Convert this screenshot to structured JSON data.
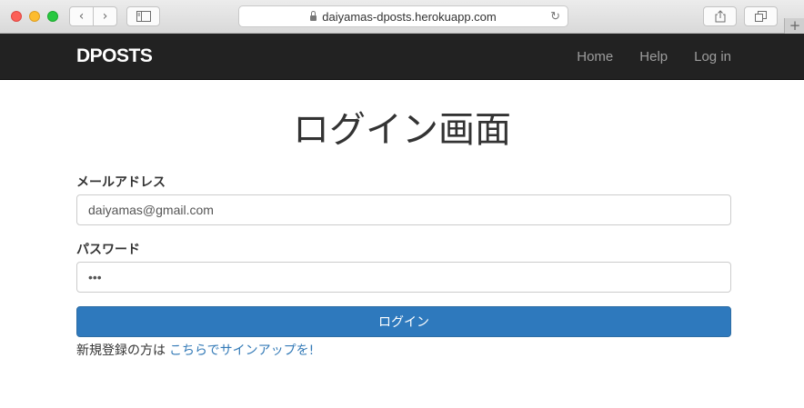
{
  "browser": {
    "url": "daiyamas-dposts.herokuapp.com",
    "back_icon": "chevron-left-icon",
    "forward_icon": "chevron-right-icon",
    "sidebar_icon": "sidebar-icon",
    "share_icon": "share-icon",
    "tabs_icon": "tabs-icon",
    "new_tab_label": "+"
  },
  "navbar": {
    "brand": "DPOSTS",
    "links": [
      "Home",
      "Help",
      "Log in"
    ]
  },
  "main": {
    "title": "ログイン画面",
    "email_label": "メールアドレス",
    "email_value": "daiyamas@gmail.com",
    "password_label": "パスワード",
    "password_value": "•••",
    "submit_label": "ログイン",
    "signup_prefix": "新規登録の方は",
    "signup_link": "こちらでサインアップを!"
  },
  "colors": {
    "navbar_bg": "#222222",
    "primary_button": "#2e79bd",
    "link": "#337ab7"
  }
}
